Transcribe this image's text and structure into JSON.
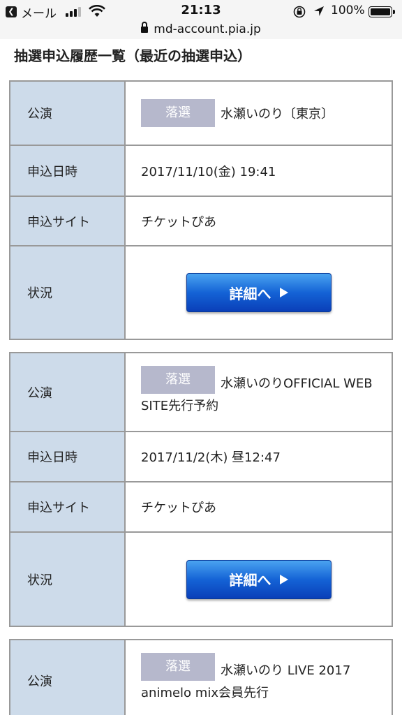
{
  "status_bar": {
    "back_icon": "back-arrow-icon",
    "carrier": "メール",
    "time": "21:13",
    "battery_percent": "100%",
    "battery_level": 1.0,
    "signal_bars": 4,
    "signal_bars_active": 3
  },
  "url_bar": {
    "domain": "md-account.pia.jp"
  },
  "page": {
    "title": "抽選申込履歴一覧（最近の抽選申込）"
  },
  "labels": {
    "performance": "公演",
    "applied_at": "申込日時",
    "site": "申込サイト",
    "status": "状況"
  },
  "entries": [
    {
      "badge": "落選",
      "performance": "水瀬いのり〔東京〕",
      "applied_at": "2017/11/10(金) 19:41",
      "site": "チケットぴあ",
      "button": "詳細へ"
    },
    {
      "badge": "落選",
      "performance": "水瀬いのりOFFICIAL WEB SITE先行予約",
      "applied_at": "2017/11/2(木) 昼12:47",
      "site": "チケットぴあ",
      "button": "詳細へ"
    },
    {
      "badge": "落選",
      "performance": "水瀬いのり LIVE 2017 animelo mix会員先行"
    }
  ],
  "colors": {
    "label_bg": "#cddbea",
    "badge_bg": "#b6b8cc",
    "button_blue": "#1463d6",
    "border": "#999999"
  }
}
